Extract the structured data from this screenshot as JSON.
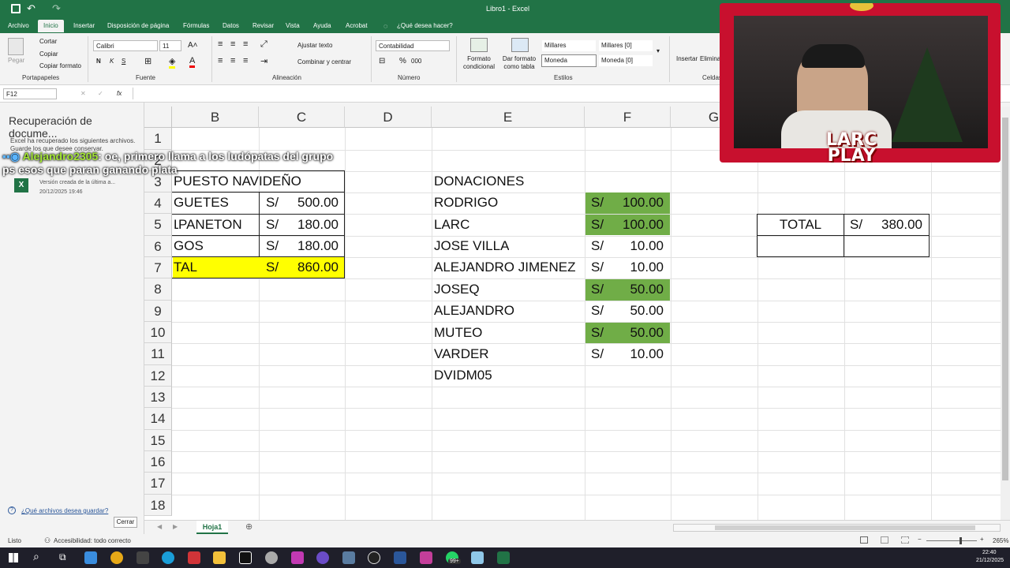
{
  "window": {
    "title": "Libro1  -  Excel"
  },
  "ribbon_tabs": [
    "Archivo",
    "Inicio",
    "Insertar",
    "Disposición de página",
    "Fórmulas",
    "Datos",
    "Revisar",
    "Vista",
    "Ayuda",
    "Acrobat",
    "¿Qué desea hacer?"
  ],
  "ribbon": {
    "clipboard": {
      "paste": "Pegar",
      "cut": "Cortar",
      "copy": "Copiar",
      "copy_format": "Copiar formato",
      "label": "Portapapeles"
    },
    "font": {
      "name": "Calibri",
      "size": "11",
      "label": "Fuente",
      "bold": "N",
      "italic": "K",
      "underline": "S"
    },
    "alignment": {
      "wrap": "Ajustar texto",
      "merge": "Combinar y centrar",
      "label": "Alineación"
    },
    "number": {
      "format": "Contabilidad",
      "label": "Número",
      "percent": "%",
      "comma": "000"
    },
    "styles": {
      "conditional": "Formato condicional",
      "table": "Dar formato como tabla",
      "s1": "Millares",
      "s2": "Millares [0]",
      "s3": "Moneda",
      "s4": "Moneda [0]",
      "label": "Estilos"
    },
    "cells": {
      "insert": "Insertar",
      "delete": "Eliminar",
      "label": "Celdas"
    }
  },
  "formula_bar": {
    "name_box": "F12",
    "fx": "fx",
    "content": ""
  },
  "recovery_pane": {
    "title": "Recuperación de docume...",
    "description": "Excel ha recuperado los siguientes archivos. Guarde los que desee conservar.",
    "file_version": "Versión creada de la última a...",
    "file_date": "20/12/2025 19:46",
    "link": "¿Qué archivos desea guardar?",
    "close": "Cerrar"
  },
  "chat": {
    "user": "Alejandro2305",
    "message": ": oe, primero llama a los ludópatas del grupo ps esos que paran ganando plata"
  },
  "grid": {
    "columns": [
      "B",
      "C",
      "D",
      "E",
      "F",
      "G"
    ],
    "rows": [
      "1",
      "2",
      "3",
      "4",
      "5",
      "6",
      "7",
      "8",
      "9",
      "10",
      "11",
      "12",
      "13",
      "14",
      "15",
      "16",
      "17",
      "18"
    ],
    "budget": {
      "title": "PUESTO NAVIDEÑO",
      "items": [
        {
          "label": "GUETES",
          "cur": "S/",
          "amount": "500.00"
        },
        {
          "label": "PANETON",
          "cur": "S/",
          "amount": "180.00"
        },
        {
          "label": "GOS",
          "cur": "S/",
          "amount": "180.00"
        },
        {
          "label": "TAL",
          "cur": "S/",
          "amount": "860.00"
        }
      ],
      "prefix_mark": "L"
    },
    "donations": {
      "title": "DONACIONES",
      "items": [
        {
          "name": "RODRIGO",
          "cur": "S/",
          "amount": "100.00",
          "highlight": true
        },
        {
          "name": "LARC",
          "cur": "S/",
          "amount": "100.00",
          "highlight": true
        },
        {
          "name": "JOSE VILLA",
          "cur": "S/",
          "amount": "10.00",
          "highlight": false
        },
        {
          "name": "ALEJANDRO JIMENEZ",
          "cur": "S/",
          "amount": "10.00",
          "highlight": false
        },
        {
          "name": "JOSEQ",
          "cur": "S/",
          "amount": "50.00",
          "highlight": true
        },
        {
          "name": "ALEJANDRO",
          "cur": "S/",
          "amount": "50.00",
          "highlight": false
        },
        {
          "name": "MUTEO",
          "cur": "S/",
          "amount": "50.00",
          "highlight": true
        },
        {
          "name": "VARDER",
          "cur": "S/",
          "amount": "10.00",
          "highlight": false
        },
        {
          "name": "DVIDM05",
          "cur": "",
          "amount": "",
          "highlight": false
        }
      ]
    },
    "total": {
      "label": "TOTAL",
      "cur": "S/",
      "amount": "380.00"
    }
  },
  "sheet_tabs": {
    "active": "Hoja1"
  },
  "status": {
    "ready": "Listo",
    "accessibility": "Accesibilidad: todo correcto",
    "zoom": "265%"
  },
  "webcam": {
    "brand_line1": "LARC",
    "brand_line2": "PLAY"
  },
  "taskbar": {
    "time": "22:40",
    "date": "21/12/2025",
    "badge": "99+"
  },
  "colors": {
    "excel_green": "#217346",
    "cell_green": "#70ad47",
    "cell_yellow": "#ffff00",
    "frame_red": "#c8102e"
  }
}
